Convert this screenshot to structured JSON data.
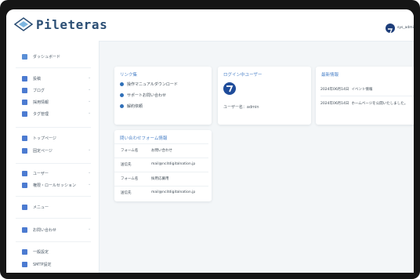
{
  "header": {
    "logo_text": "Pileteras",
    "logo_sub": "",
    "user_name": "sys_admin",
    "logo_icon": "diamond-logo-icon"
  },
  "sidebar": {
    "items": [
      {
        "label": "ダッシュボード",
        "icon": "grid-icon",
        "chevron": false
      },
      {
        "label": "投稿",
        "icon": "pin-icon",
        "chevron": true
      },
      {
        "label": "ブログ",
        "icon": "edit-icon",
        "chevron": true
      },
      {
        "label": "採用情報",
        "icon": "calendar-icon",
        "chevron": true
      },
      {
        "label": "タグ管理",
        "icon": "tag-icon",
        "chevron": true
      },
      {
        "label": "トップページ",
        "icon": "monitor-icon",
        "chevron": false
      },
      {
        "label": "固定ページ",
        "icon": "page-icon",
        "chevron": true
      },
      {
        "label": "ユーザー",
        "icon": "user-icon",
        "chevron": true
      },
      {
        "label": "権限・ロールセッション",
        "icon": "lock-icon",
        "chevron": true
      },
      {
        "label": "メニュー",
        "icon": "menu-icon",
        "chevron": false
      },
      {
        "label": "お問い合わせ",
        "icon": "mail-icon",
        "chevron": true
      },
      {
        "label": "一般設定",
        "icon": "gear-icon",
        "chevron": false
      },
      {
        "label": "SMTP設定",
        "icon": "server-icon",
        "chevron": false
      }
    ]
  },
  "links_card": {
    "title": "リンク集",
    "links": [
      "操作マニュアルダウンロード",
      "サポートお問い合わせ",
      "解約依頼"
    ]
  },
  "login_card": {
    "title": "ログイン中ユーザー",
    "user_label": "ユーザー名：admin"
  },
  "news_card": {
    "title": "最新情報",
    "rows": [
      {
        "date": "2024年06月14日",
        "text": "イベント情報"
      },
      {
        "date": "2024年06月14日",
        "text": "ホームページを公開いたしました。"
      }
    ]
  },
  "form_card": {
    "title": "問い合わせフォーム情報",
    "rows": [
      {
        "key": "フォーム名",
        "value": "お問い合わせ"
      },
      {
        "key": "送信先",
        "value": "mail@ncitdigitalnation.jp"
      },
      {
        "key": "フォーム名",
        "value": "採用応募用"
      },
      {
        "key": "送信先",
        "value": "mail@ncitdigitalnation.jp"
      }
    ]
  },
  "colors": {
    "accent": "#4b82c8",
    "brand": "#2b4e74",
    "icon": "#4c7bd1"
  }
}
